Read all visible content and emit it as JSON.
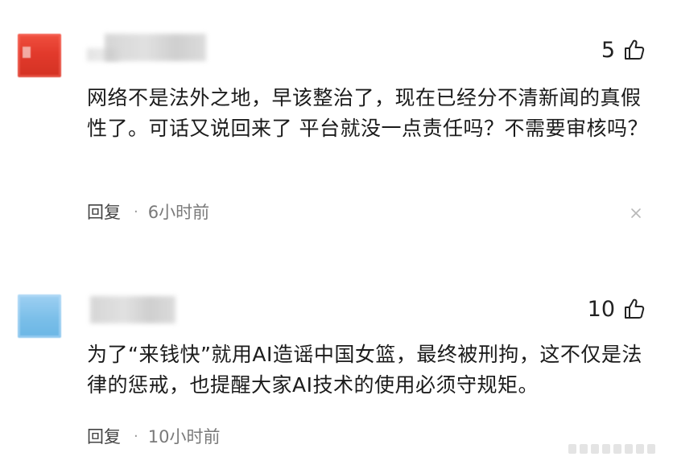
{
  "comments": [
    {
      "likes": "5",
      "text": "网络不是法外之地，早该整治了，现在已经分不清新闻的真假性了。可话又说回来了 平台就没一点责任吗？不需要审核吗？",
      "reply_label": "回复",
      "separator": "·",
      "time": "6小时前"
    },
    {
      "likes": "10",
      "text": "为了“来钱快”就用AI造谣中国女篮，最终被刑拘，这不仅是法律的惩戒，也提醒大家AI技术的使用必须守规矩。",
      "reply_label": "回复",
      "separator": "·",
      "time": "10小时前"
    }
  ],
  "icons": {
    "like": "thumbs-up-icon",
    "dismiss": "close-icon"
  },
  "colors": {
    "avatar_1": "#e23a2c",
    "avatar_2": "#7bbfe9",
    "text": "#1b1b1b",
    "meta": "#7a7a7a"
  }
}
